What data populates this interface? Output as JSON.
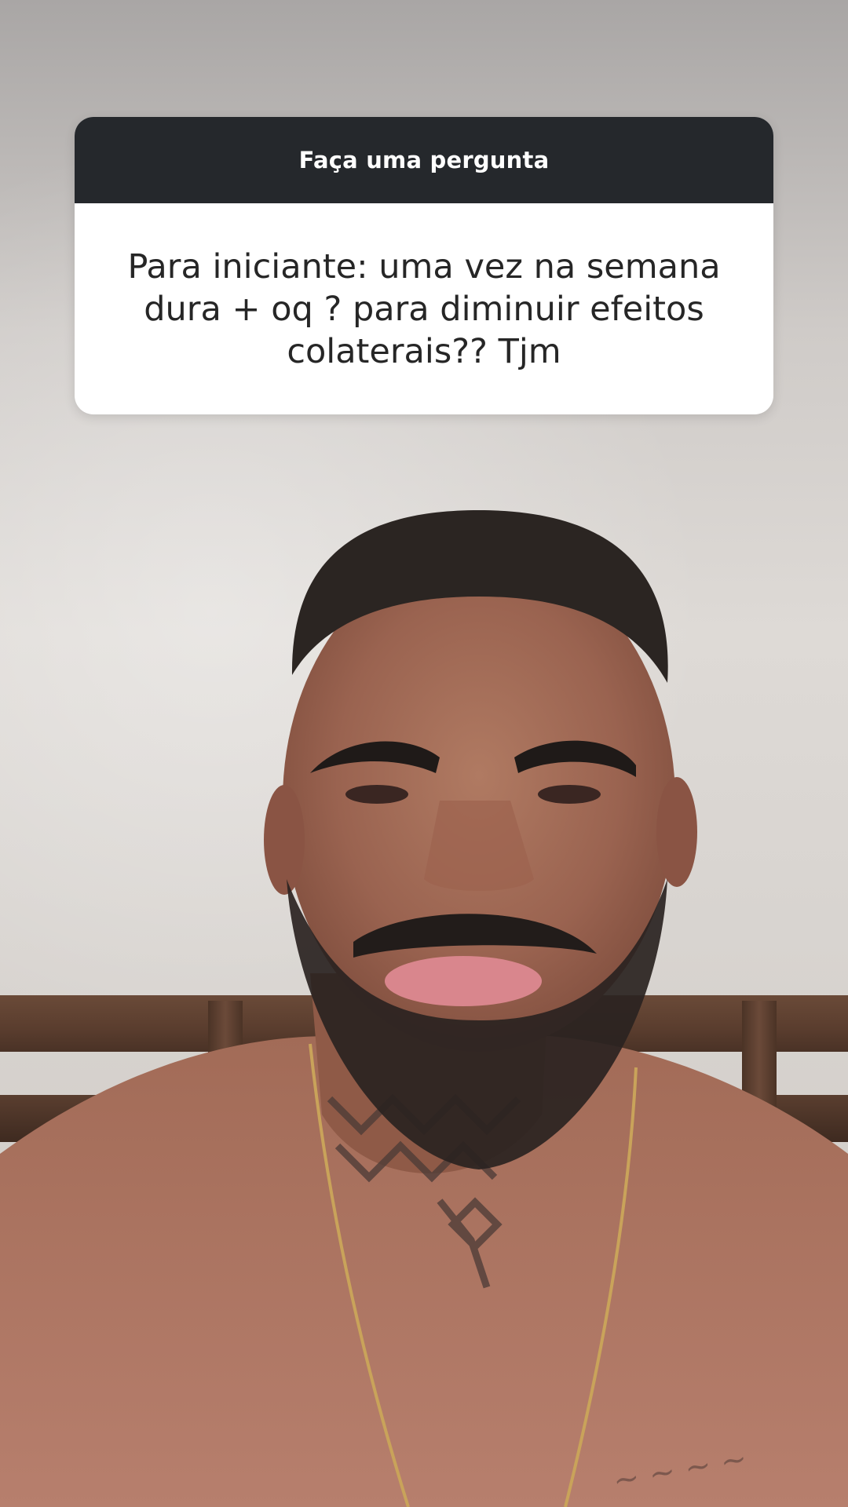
{
  "story": {
    "background": "photo",
    "question_sticker": {
      "header": "Faça uma pergunta",
      "question": "Para iniciante: uma vez na semana dura + oq ? para diminuir efeitos colaterais?? Tjm",
      "header_color": "#25282c",
      "body_color": "#ffffff",
      "text_color": "#262626"
    }
  }
}
